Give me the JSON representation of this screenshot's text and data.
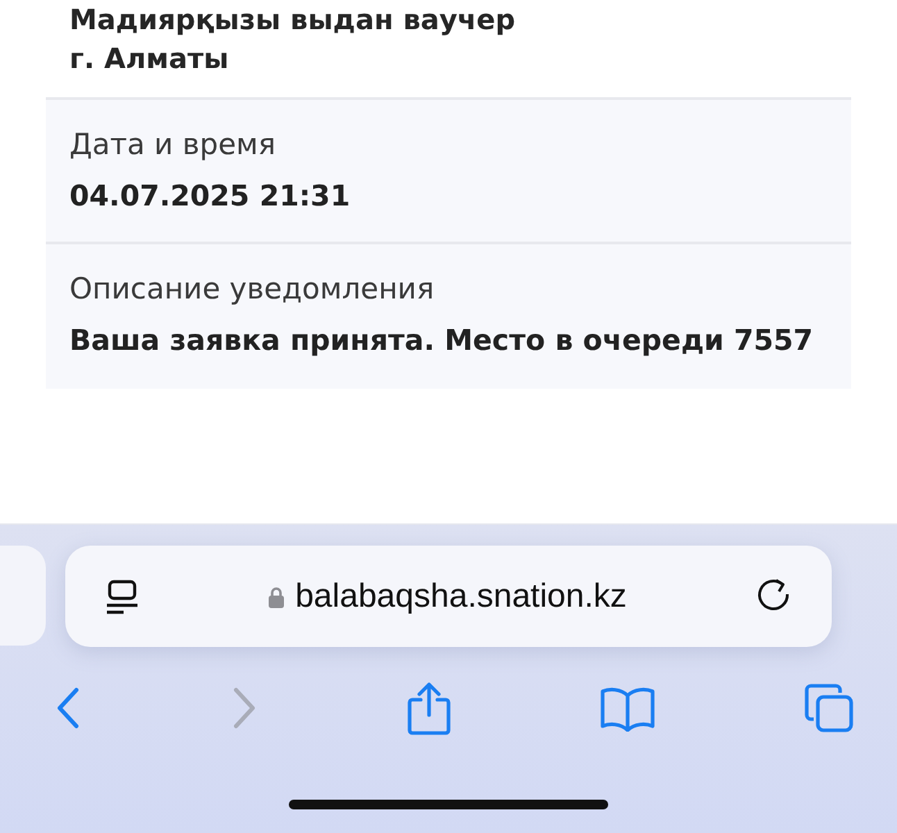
{
  "notification": {
    "header_lines": [
      "Мадиярқызы выдан ваучер",
      "г. Алматы"
    ],
    "fields": [
      {
        "label": "Дата и время",
        "value": "04.07.2025 21:31"
      },
      {
        "label": "Описание уведомления",
        "value": "Ваша заявка принята. Место в очереди 7557"
      }
    ]
  },
  "browser": {
    "address": "balabaqsha.snation.kz",
    "secure": true,
    "toolbar": [
      {
        "kind": "back",
        "disabled": false
      },
      {
        "kind": "forward",
        "disabled": true
      },
      {
        "kind": "share",
        "disabled": false
      },
      {
        "kind": "bookmarks",
        "disabled": false
      },
      {
        "kind": "tabs",
        "disabled": false
      }
    ]
  }
}
